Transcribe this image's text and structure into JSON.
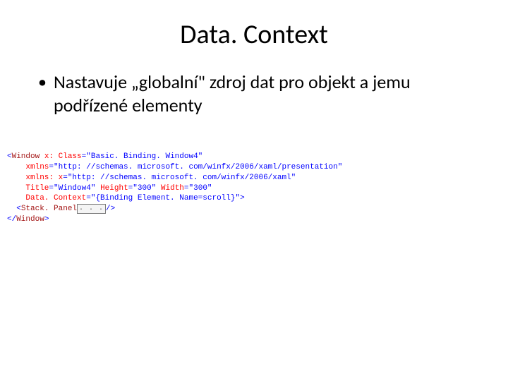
{
  "title": "Data. Context",
  "bullet": "Nastavuje „globalní\" zdroj dat pro objekt a jemu podřízené elementy",
  "code": {
    "tag_open": "<",
    "tag_close": ">",
    "tag_close_slash": "</",
    "tag_self_close": "/>",
    "eq": "=",
    "window": "Window",
    "stackpanel": "Stack. Panel",
    "attr_class": "x: Class",
    "val_class": "\"Basic. Binding. Window4\"",
    "attr_xmlns": "xmlns",
    "val_xmlns": "\"http: //schemas. microsoft. com/winfx/2006/xaml/presentation\"",
    "attr_xmlnsx": "xmlns: x",
    "val_xmlnsx": "\"http: //schemas. microsoft. com/winfx/2006/xaml\"",
    "attr_title": "Title",
    "val_title": "\"Window4\"",
    "attr_height": "Height",
    "val_height": "\"300\"",
    "attr_width": "Width",
    "val_width": "\"300\"",
    "attr_datactx": "Data. Context",
    "val_datactx": "\"{Binding Element. Name=scroll}\"",
    "collapsed": ". . .",
    "indent1": "    ",
    "indent2": "  ",
    "sp": " "
  }
}
